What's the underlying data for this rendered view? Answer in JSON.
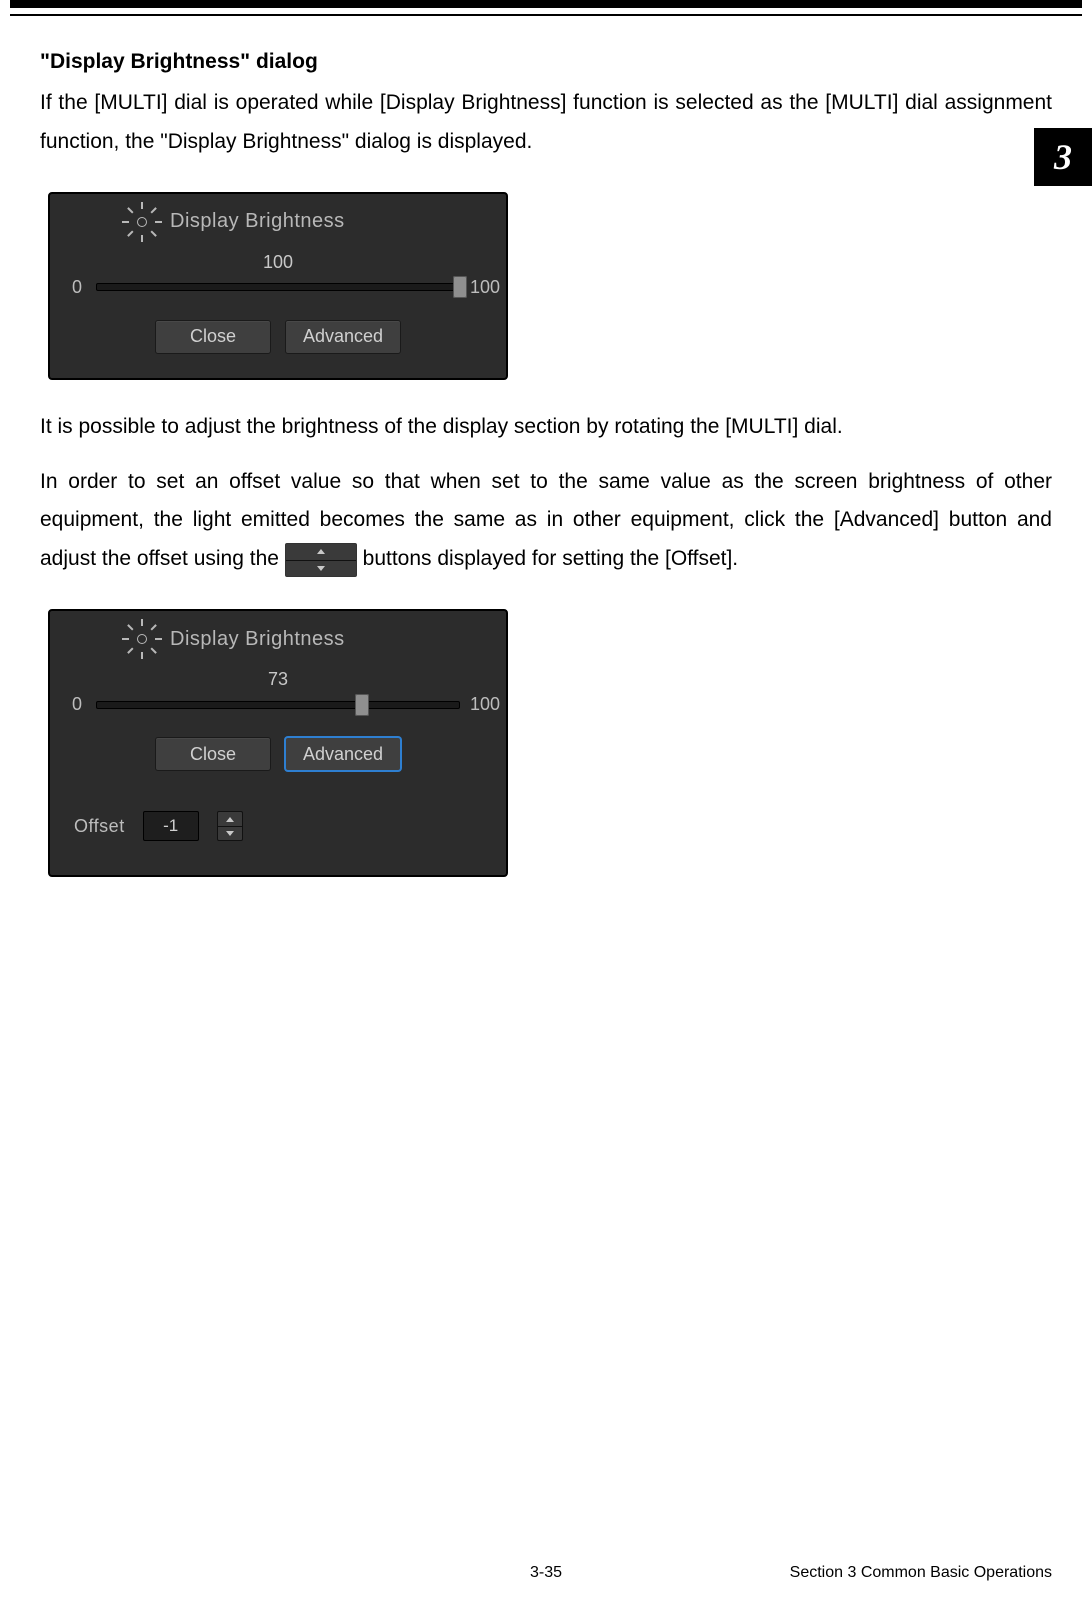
{
  "side_tab": "3",
  "heading": "\"Display Brightness\" dialog",
  "para1": "If the [MULTI] dial is operated while [Display Brightness] function is selected as the [MULTI] dial assignment function, the \"Display Brightness\" dialog is displayed.",
  "dialog1": {
    "title": "Display Brightness",
    "value": "100",
    "min": "0",
    "max": "100",
    "thumb_percent": 100,
    "close": "Close",
    "advanced": "Advanced"
  },
  "para2": "It is possible to adjust the brightness of the display section by rotating the [MULTI] dial.",
  "para3a": "In order to set an offset value so that when set to the same value as the screen brightness of other equipment, the light emitted becomes the same as in other equipment, click the [Advanced] button and adjust the offset using the",
  "para3b": "buttons displayed for setting the [Offset].",
  "dialog2": {
    "title": "Display Brightness",
    "value": "73",
    "min": "0",
    "max": "100",
    "thumb_percent": 73,
    "close": "Close",
    "advanced": "Advanced",
    "offset_label": "Offset",
    "offset_value": "-1"
  },
  "footer": {
    "page": "3-35",
    "section": "Section 3    Common Basic Operations"
  }
}
